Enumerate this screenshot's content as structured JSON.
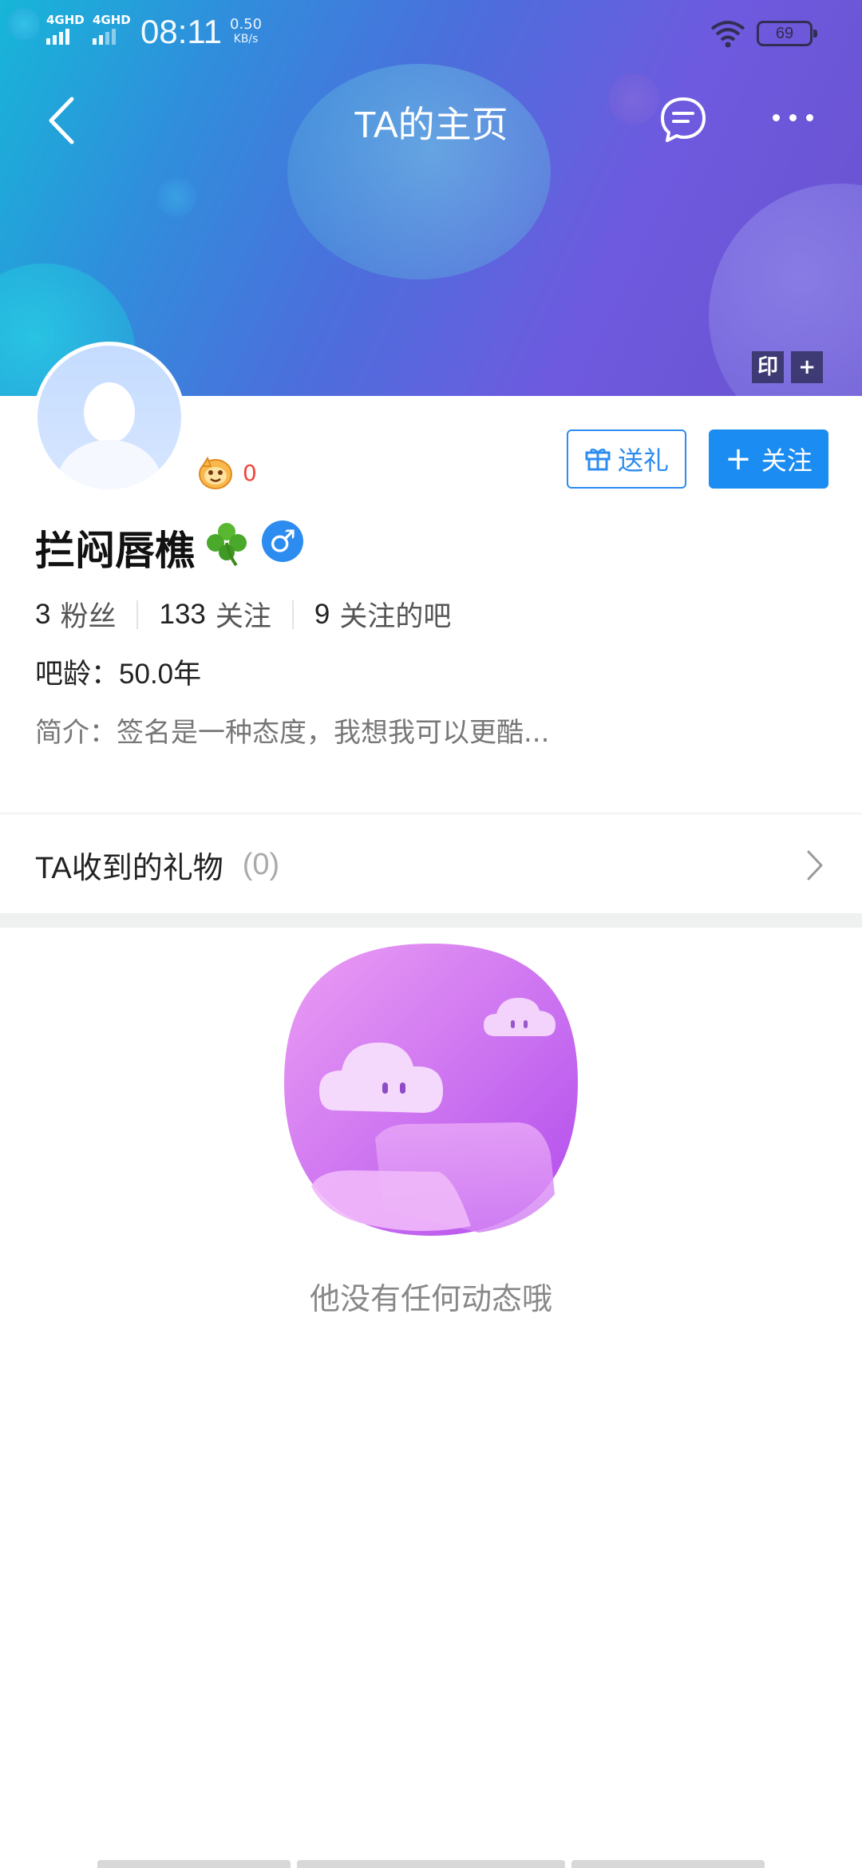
{
  "status_bar": {
    "network_1": "4GHD",
    "network_2": "4GHD",
    "time": "08:11",
    "speed_value": "0.50",
    "speed_unit": "KB/s",
    "battery": "69"
  },
  "header": {
    "title": "TA的主页",
    "stamp_label": "印",
    "add_label": "+"
  },
  "profile": {
    "level_count": "0",
    "gift_label": "送礼",
    "follow_label": "关注",
    "name": "拦闷唇樵",
    "gender_symbol": "♂",
    "stats": [
      {
        "num": "3",
        "label": "粉丝"
      },
      {
        "num": "133",
        "label": "关注"
      },
      {
        "num": "9",
        "label": "关注的吧"
      }
    ],
    "age_label": "吧龄：",
    "age_value": "50.0年",
    "bio_label": "简介：",
    "bio_value": "签名是一种态度，我想我可以更酷..."
  },
  "gifts": {
    "title": "TA收到的礼物",
    "count": "(0)"
  },
  "empty_state": {
    "text": "他没有任何动态哦"
  },
  "colors": {
    "accent": "#1a8cf2",
    "level_red": "#f0443a",
    "illus_purple": "#c45af0"
  }
}
